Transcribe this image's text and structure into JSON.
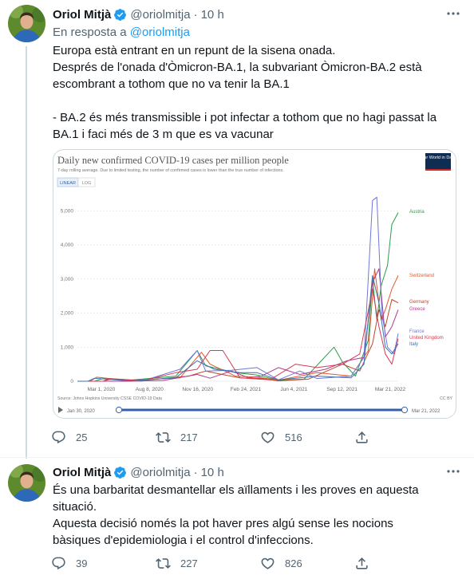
{
  "tweets": [
    {
      "author_name": "Oriol Mitjà",
      "handle": "@oriolmitja",
      "separator": "·",
      "time": "10 h",
      "reply_prefix": "En resposta a",
      "reply_to": "@oriolmitja",
      "text": "Europa està entrant en un repunt de la sisena onada.\nDesprés de l'onada d'Òmicron-BA.1, la subvariant Òmicron-BA.2 està escombrant a tothom que no va tenir la BA.1\n\n- BA.2 és més transmissible i pot infectar a tothom que no hagi passat la BA.1 i faci més de 3 m que es va vacunar",
      "reply_count": "25",
      "retweet_count": "217",
      "like_count": "516"
    },
    {
      "author_name": "Oriol Mitjà",
      "handle": "@oriolmitja",
      "separator": "·",
      "time": "10 h",
      "text": "És una barbaritat desmantellar els aïllaments i les proves en aquesta situació.\nAquesta decisió només la pot haver pres algú sense les nocions bàsiques d'epidemiologia i el control d'infeccions.",
      "reply_count": "39",
      "retweet_count": "227",
      "like_count": "826"
    }
  ],
  "icons": [
    "more-icon",
    "verified-badge-icon",
    "reply-icon",
    "retweet-icon",
    "like-icon",
    "share-icon",
    "play-icon"
  ],
  "colors": {
    "accent": "#1d9bf0",
    "text_primary": "#0f1419",
    "text_secondary": "#536471",
    "border": "#cfd9de"
  },
  "chart_data": {
    "type": "line",
    "title": "Daily new confirmed COVID-19 cases per million people",
    "subtitle": "7-day rolling average. Due to limited testing, the number of confirmed cases is lower than the true number of infections.",
    "logo": "Our World in Data",
    "scale_toggle": [
      "LINEAR",
      "LOG"
    ],
    "active_scale": "LINEAR",
    "x_ticks": [
      "Mar 1, 2020",
      "Aug 8, 2020",
      "Nov 16, 2020",
      "Feb 24, 2021",
      "Jun 4, 2021",
      "Sep 12, 2021",
      "Mar 21, 2022"
    ],
    "y_ticks": [
      "0",
      "1,000",
      "2,000",
      "3,000",
      "4,000",
      "5,000"
    ],
    "ylim": [
      0,
      5500
    ],
    "xlim_days": [
      0,
      750
    ],
    "source": "Source: Johns Hopkins University CSSE COVID-19 Data",
    "license": "CC BY",
    "timeline_start": "Jan 30, 2020",
    "timeline_end": "Mar 21, 2022",
    "series": [
      {
        "name": "Austria",
        "color": "#2a9d4a",
        "label_value": 4950,
        "points": [
          [
            0,
            0
          ],
          [
            40,
            0
          ],
          [
            60,
            80
          ],
          [
            120,
            30
          ],
          [
            230,
            150
          ],
          [
            280,
            900
          ],
          [
            300,
            450
          ],
          [
            370,
            250
          ],
          [
            420,
            180
          ],
          [
            470,
            30
          ],
          [
            530,
            60
          ],
          [
            600,
            1000
          ],
          [
            620,
            560
          ],
          [
            650,
            150
          ],
          [
            680,
            1200
          ],
          [
            690,
            3000
          ],
          [
            700,
            1800
          ],
          [
            710,
            2800
          ],
          [
            725,
            3400
          ],
          [
            735,
            4600
          ],
          [
            750,
            4950
          ]
        ]
      },
      {
        "name": "Switzerland",
        "color": "#e05a2b",
        "label_value": 3100,
        "points": [
          [
            0,
            0
          ],
          [
            30,
            0
          ],
          [
            45,
            120
          ],
          [
            120,
            20
          ],
          [
            240,
            100
          ],
          [
            290,
            850
          ],
          [
            310,
            500
          ],
          [
            370,
            150
          ],
          [
            420,
            120
          ],
          [
            470,
            30
          ],
          [
            560,
            250
          ],
          [
            640,
            150
          ],
          [
            680,
            900
          ],
          [
            695,
            3300
          ],
          [
            710,
            1800
          ],
          [
            720,
            2100
          ],
          [
            735,
            2700
          ],
          [
            750,
            3100
          ]
        ]
      },
      {
        "name": "Germany",
        "color": "#c2452a",
        "label_value": 2300,
        "points": [
          [
            0,
            0
          ],
          [
            60,
            0
          ],
          [
            75,
            80
          ],
          [
            150,
            20
          ],
          [
            260,
            150
          ],
          [
            300,
            300
          ],
          [
            330,
            220
          ],
          [
            380,
            100
          ],
          [
            430,
            80
          ],
          [
            470,
            10
          ],
          [
            540,
            60
          ],
          [
            620,
            500
          ],
          [
            660,
            300
          ],
          [
            690,
            1100
          ],
          [
            705,
            2100
          ],
          [
            720,
            1600
          ],
          [
            735,
            2400
          ],
          [
            750,
            2300
          ]
        ]
      },
      {
        "name": "Greece",
        "color": "#b33a8c",
        "label_value": 2100,
        "points": [
          [
            0,
            0
          ],
          [
            120,
            0
          ],
          [
            200,
            20
          ],
          [
            280,
            200
          ],
          [
            310,
            90
          ],
          [
            360,
            300
          ],
          [
            400,
            100
          ],
          [
            430,
            150
          ],
          [
            470,
            400
          ],
          [
            520,
            200
          ],
          [
            580,
            350
          ],
          [
            630,
            600
          ],
          [
            670,
            700
          ],
          [
            690,
            2900
          ],
          [
            705,
            3300
          ],
          [
            720,
            1300
          ],
          [
            735,
            1600
          ],
          [
            750,
            2100
          ]
        ]
      },
      {
        "name": "France",
        "color": "#6f77d6",
        "label_value": 1400,
        "points": [
          [
            0,
            0
          ],
          [
            60,
            0
          ],
          [
            75,
            70
          ],
          [
            150,
            0
          ],
          [
            240,
            350
          ],
          [
            280,
            900
          ],
          [
            300,
            300
          ],
          [
            360,
            320
          ],
          [
            420,
            400
          ],
          [
            470,
            40
          ],
          [
            520,
            300
          ],
          [
            560,
            80
          ],
          [
            640,
            150
          ],
          [
            670,
            700
          ],
          [
            690,
            5300
          ],
          [
            700,
            5400
          ],
          [
            712,
            2000
          ],
          [
            725,
            1000
          ],
          [
            740,
            800
          ],
          [
            750,
            1400
          ]
        ]
      },
      {
        "name": "United Kingdom",
        "color": "#d63a55",
        "label_value": 1250,
        "points": [
          [
            0,
            0
          ],
          [
            60,
            0
          ],
          [
            80,
            70
          ],
          [
            150,
            10
          ],
          [
            230,
            250
          ],
          [
            280,
            350
          ],
          [
            310,
            900
          ],
          [
            340,
            900
          ],
          [
            380,
            100
          ],
          [
            450,
            40
          ],
          [
            510,
            500
          ],
          [
            560,
            400
          ],
          [
            620,
            500
          ],
          [
            660,
            800
          ],
          [
            690,
            2700
          ],
          [
            705,
            1600
          ],
          [
            720,
            800
          ],
          [
            735,
            500
          ],
          [
            750,
            1250
          ]
        ]
      },
      {
        "name": "Italy",
        "color": "#3d6fb0",
        "label_value": 1100,
        "points": [
          [
            0,
            0
          ],
          [
            25,
            0
          ],
          [
            40,
            90
          ],
          [
            120,
            10
          ],
          [
            230,
            100
          ],
          [
            280,
            600
          ],
          [
            320,
            350
          ],
          [
            380,
            250
          ],
          [
            420,
            250
          ],
          [
            470,
            40
          ],
          [
            560,
            150
          ],
          [
            640,
            100
          ],
          [
            670,
            500
          ],
          [
            690,
            3100
          ],
          [
            705,
            2300
          ],
          [
            720,
            1000
          ],
          [
            735,
            800
          ],
          [
            750,
            1100
          ]
        ]
      }
    ]
  }
}
